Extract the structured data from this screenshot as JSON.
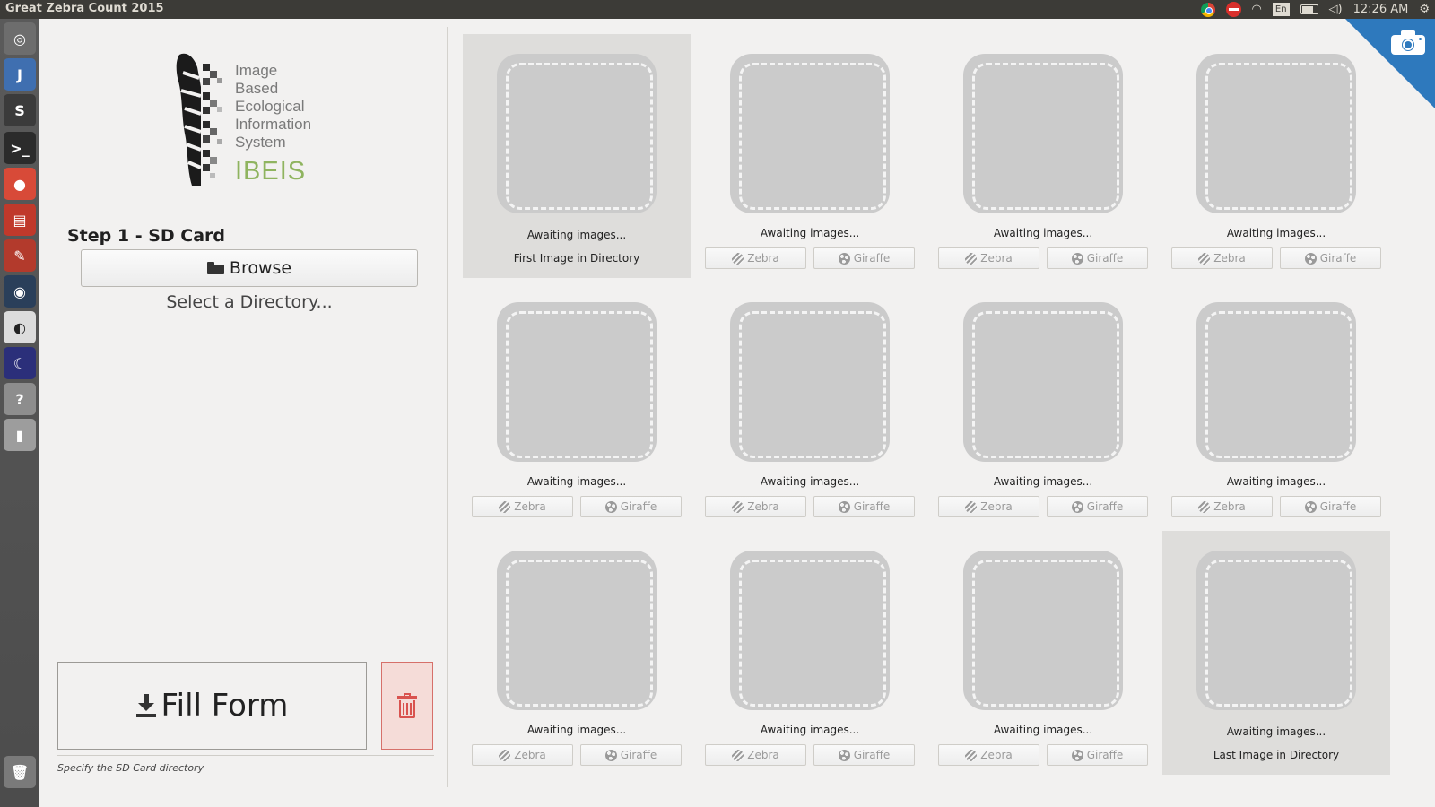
{
  "window": {
    "title": "Great Zebra Count 2015"
  },
  "topbar": {
    "lang": "En",
    "time": "12:26 AM"
  },
  "launcher": {
    "apps": [
      {
        "name": "dash-icon",
        "glyph": "◎",
        "bg": "#6d6d6d"
      },
      {
        "name": "text-editor-icon",
        "glyph": "J",
        "bg": "#3f6fb0"
      },
      {
        "name": "sublime-text-icon",
        "glyph": "S",
        "bg": "#3b3b3b"
      },
      {
        "name": "terminal-icon",
        "glyph": ">_",
        "bg": "#2b2b2b"
      },
      {
        "name": "chrome-icon",
        "glyph": "●",
        "bg": "#d84a38"
      },
      {
        "name": "files-icon",
        "glyph": "▤",
        "bg": "#c0392b"
      },
      {
        "name": "system-settings-icon",
        "glyph": "✎",
        "bg": "#b33a2c"
      },
      {
        "name": "steam-icon",
        "glyph": "◉",
        "bg": "#2a3f5a"
      },
      {
        "name": "ibeis-icon",
        "glyph": "◐",
        "bg": "#dcdcdc"
      },
      {
        "name": "night-app-icon",
        "glyph": "☾",
        "bg": "#2b2f7a"
      },
      {
        "name": "help-icon",
        "glyph": "?",
        "bg": "#8d8d8d"
      },
      {
        "name": "usb-drive-icon",
        "glyph": "▮",
        "bg": "#9d9d9d"
      }
    ],
    "trash": {
      "name": "trash-launcher-icon",
      "glyph": "🗑",
      "bg": "#7a7a7a"
    }
  },
  "logo": {
    "words": [
      "Image",
      "Based",
      "Ecological",
      "Information",
      "System"
    ],
    "acronym": "IBEIS"
  },
  "step1": {
    "title": "Step 1 - SD Card",
    "browse_label": "Browse",
    "directory_text": "Select a Directory..."
  },
  "actions": {
    "fill_form_label": "Fill Form"
  },
  "status": {
    "text": "Specify the SD Card directory"
  },
  "grid": {
    "awaiting_text": "Awaiting images...",
    "zebra_label": "Zebra",
    "giraffe_label": "Giraffe",
    "first_label": "First Image in Directory",
    "last_label": "Last Image in Directory"
  },
  "colors": {
    "accent": "#2e79bd",
    "ibeis_green": "#8fb45f",
    "danger": "#d9534f"
  }
}
